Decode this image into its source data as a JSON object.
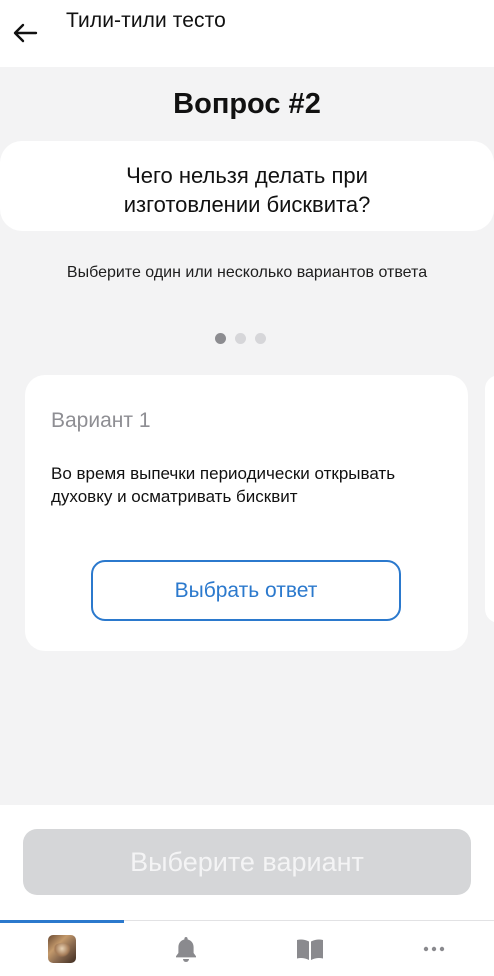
{
  "header": {
    "title": "Тили-тили тесто",
    "back_icon": "arrow-left-icon"
  },
  "question": {
    "number_label": "Вопрос #2",
    "text": "Чего нельзя делать при изготовлении бисквита?",
    "hint": "Выберите один или несколько вариантов ответа",
    "pager": {
      "total": 3,
      "current": 1
    }
  },
  "answer_card": {
    "label": "Вариант 1",
    "text": "Во время выпечки периодически открывать духовку и осматривать бисквит",
    "choose_label": "Выбрать ответ"
  },
  "footer": {
    "submit_label": "Выберите вариант"
  },
  "tabbar": {
    "tabs": [
      {
        "name": "profile",
        "icon": "avatar-icon",
        "active": true
      },
      {
        "name": "notifications",
        "icon": "bell-icon",
        "active": false
      },
      {
        "name": "library",
        "icon": "book-icon",
        "active": false
      },
      {
        "name": "more",
        "icon": "more-dots-icon",
        "active": false
      }
    ]
  },
  "colors": {
    "accent": "#2b79cd",
    "background": "#f3f3f4",
    "disabled_button": "#d5d6d8"
  }
}
